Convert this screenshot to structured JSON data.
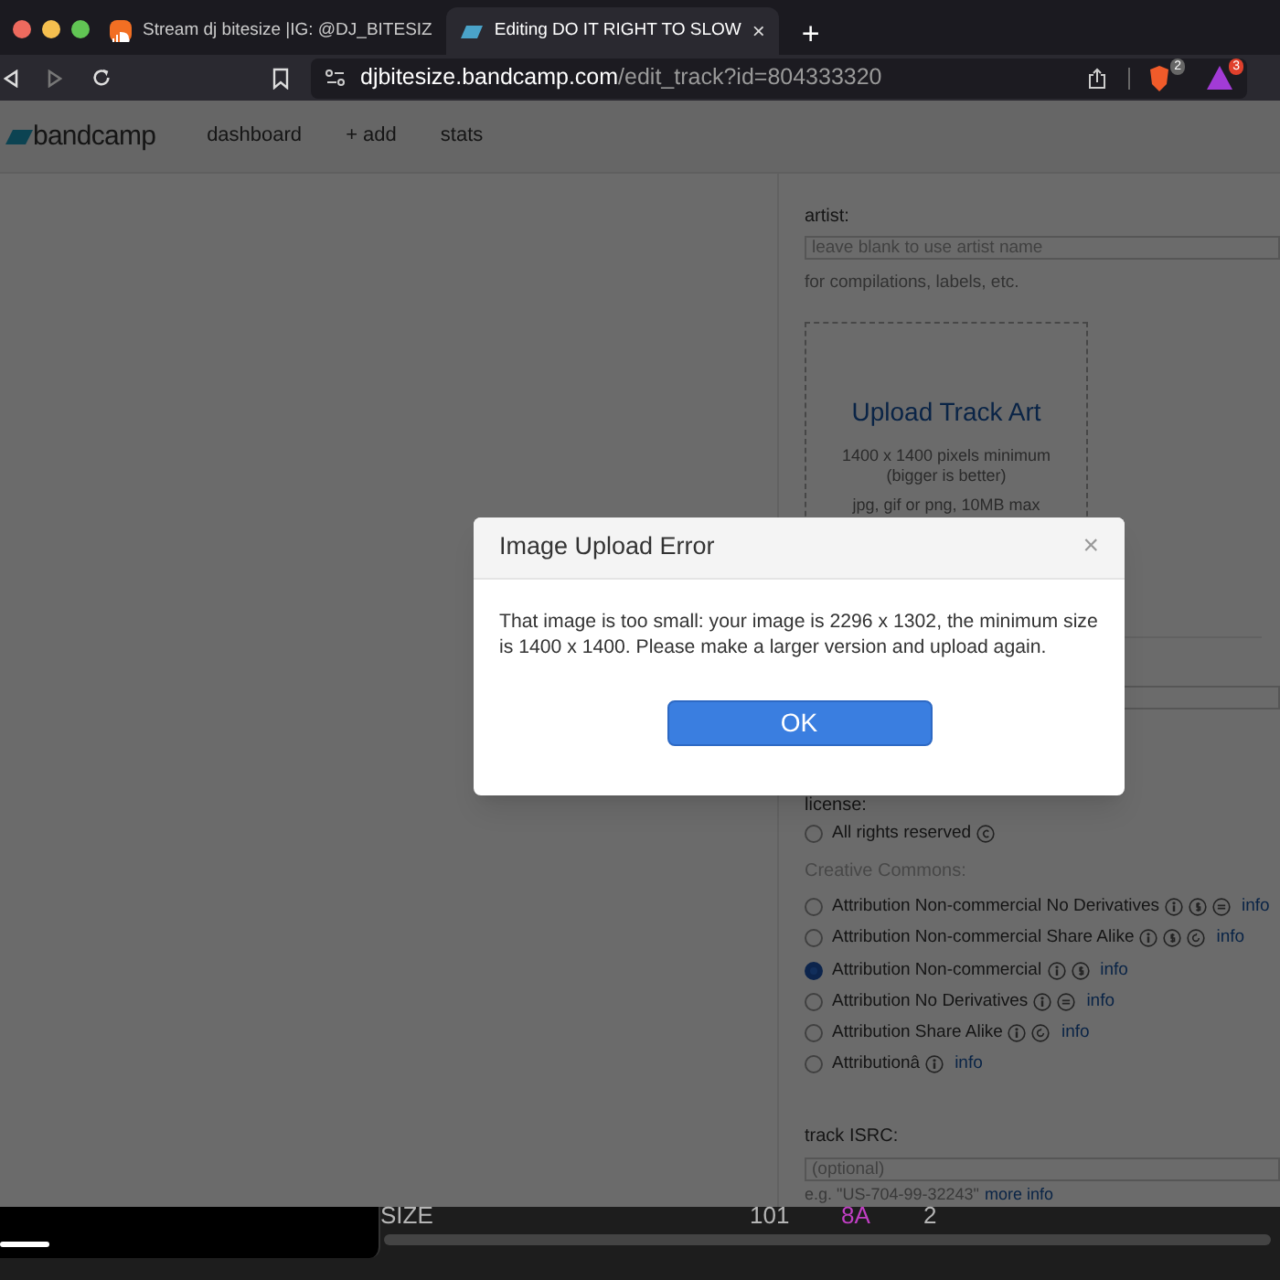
{
  "browser": {
    "tabs": [
      {
        "title": "Stream dj bitesize |IG: @DJ_BITESIZ",
        "selected": false,
        "kind": "soundcloud"
      },
      {
        "title": "Editing DO IT RIGHT TO SLOW",
        "selected": true,
        "kind": "bandcamp",
        "close": "×"
      }
    ],
    "new_tab": "+",
    "url": {
      "host": "djbitesize.bandcamp.com",
      "path": "/edit_track?id=804333320"
    },
    "extension_badges": [
      "2",
      "3"
    ]
  },
  "site_nav": {
    "logo": "bandcamp",
    "links": [
      "dashboard",
      "+ add",
      "stats"
    ]
  },
  "form": {
    "artist": {
      "label": "artist:",
      "placeholder": "leave blank to use artist name",
      "hint": "for compilations, labels, etc."
    },
    "track_art": {
      "title": "Upload Track Art",
      "lines": [
        "1400 x 1400 pixels minimum",
        "(bigger is better)"
      ],
      "formats": "jpg, gif or png, 10MB max"
    },
    "license": {
      "label": "license:",
      "cc_label": "Creative Commons:",
      "options": [
        {
          "label": "All rights reserved",
          "selected": false
        },
        {
          "label": "Attribution Non-commercial No Derivatives",
          "info": "info",
          "selected": false
        },
        {
          "label": "Attribution Non-commercial Share Alike",
          "info": "info",
          "selected": false
        },
        {
          "label": "Attribution Non-commercial",
          "info": "info",
          "selected": true
        },
        {
          "label": "Attribution No Derivatives",
          "info": "info",
          "selected": false
        },
        {
          "label": "Attribution Share Alike",
          "info": "info",
          "selected": false
        },
        {
          "label": "Attributionâ",
          "info": "info",
          "selected": false
        }
      ]
    },
    "isrc": {
      "label": "track ISRC:",
      "placeholder": "(optional)",
      "example": "e.g. \"US-704-99-32243\"",
      "link": "more info"
    }
  },
  "dialog": {
    "title": "Image Upload Error",
    "close": "×",
    "message": "That image is too small: your image is 2296 x 1302, the minimum size is 1400 x 1400. Please make a larger version and upload again.",
    "button": "OK"
  },
  "background_app": {
    "texts": [
      {
        "text": "SIZE",
        "color": "#b5b5b5"
      },
      {
        "text": "101",
        "color": "#b5b5b5"
      },
      {
        "text": "8A",
        "color": "#c13fc4"
      },
      {
        "text": "2",
        "color": "#b5b5b5"
      }
    ]
  }
}
